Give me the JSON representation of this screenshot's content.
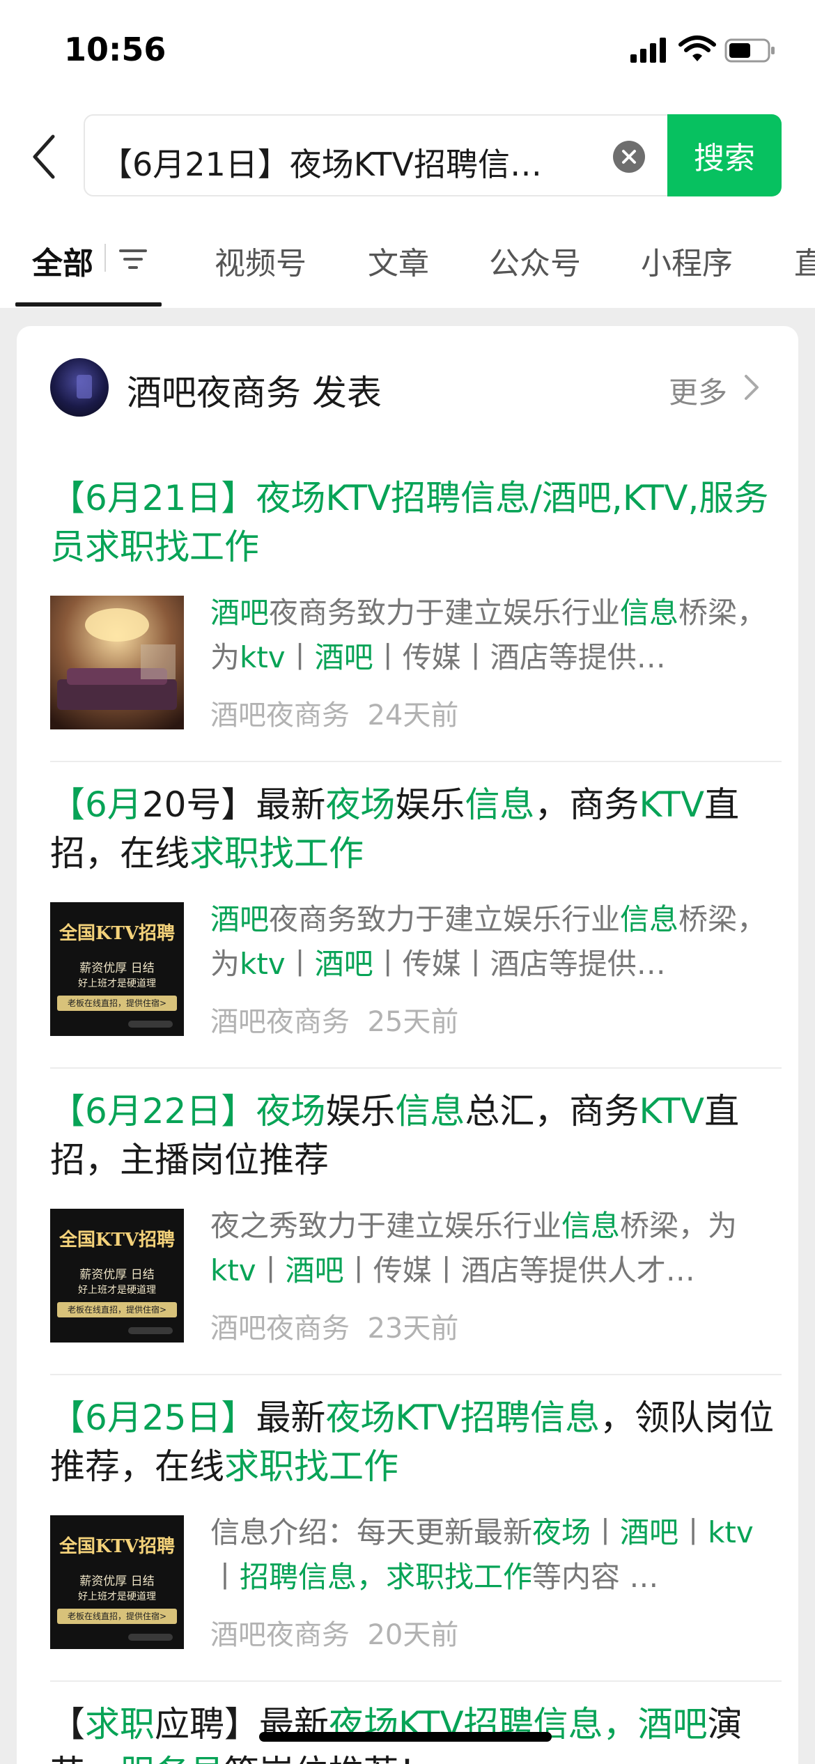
{
  "status_bar": {
    "time": "10:56"
  },
  "search": {
    "query": "【6月21日】夜场KTV招聘信…",
    "button_label": "搜索"
  },
  "tabs": [
    {
      "label": "全部",
      "active": true
    },
    {
      "label": "视频号"
    },
    {
      "label": "文章"
    },
    {
      "label": "公众号"
    },
    {
      "label": "小程序"
    },
    {
      "label": "直"
    }
  ],
  "account": {
    "name": "酒吧夜商务 发表",
    "more_label": "更多"
  },
  "articles": [
    {
      "title_segments": [
        {
          "text": "【6月21日】夜场KTV招聘信息/酒吧,KTV,服务员求职找工作",
          "hl": true
        }
      ],
      "thumb": "luxury-ktv-room-photo",
      "snippet_segments": [
        {
          "text": "酒吧",
          "hl": true
        },
        {
          "text": "夜商务致力于建立娱乐行业"
        },
        {
          "text": "信息",
          "hl": true
        },
        {
          "text": "桥梁，为"
        },
        {
          "text": "ktv",
          "hl": true
        },
        {
          "text": "丨"
        },
        {
          "text": "酒吧",
          "hl": true
        },
        {
          "text": "丨传媒丨酒店等提供…"
        }
      ],
      "source": "酒吧夜商务",
      "time": "24天前"
    },
    {
      "title_segments": [
        {
          "text": "【6月",
          "hl": true
        },
        {
          "text": "20号】最新"
        },
        {
          "text": "夜场",
          "hl": true
        },
        {
          "text": "娱乐"
        },
        {
          "text": "信息",
          "hl": true
        },
        {
          "text": "，商务"
        },
        {
          "text": "KTV",
          "hl": true
        },
        {
          "text": "直招，在线"
        },
        {
          "text": "求职找工作",
          "hl": true
        }
      ],
      "thumb": "ktv-recruit-poster",
      "snippet_segments": [
        {
          "text": "酒吧",
          "hl": true
        },
        {
          "text": "夜商务致力于建立娱乐行业"
        },
        {
          "text": "信息",
          "hl": true
        },
        {
          "text": "桥梁，为"
        },
        {
          "text": "ktv",
          "hl": true
        },
        {
          "text": "丨"
        },
        {
          "text": "酒吧",
          "hl": true
        },
        {
          "text": "丨传媒丨酒店等提供…"
        }
      ],
      "source": "酒吧夜商务",
      "time": "25天前"
    },
    {
      "title_segments": [
        {
          "text": "【6月22日】",
          "hl": true
        },
        {
          "text": "夜场",
          "hl": true
        },
        {
          "text": "娱乐"
        },
        {
          "text": "信息",
          "hl": true
        },
        {
          "text": "总汇，商务"
        },
        {
          "text": "KTV",
          "hl": true
        },
        {
          "text": "直招，主播岗位推荐"
        }
      ],
      "thumb": "ktv-recruit-poster",
      "snippet_segments": [
        {
          "text": "夜之秀致力于建立娱乐行业"
        },
        {
          "text": "信息",
          "hl": true
        },
        {
          "text": "桥梁，为"
        },
        {
          "text": "ktv",
          "hl": true
        },
        {
          "text": "丨"
        },
        {
          "text": "酒吧",
          "hl": true
        },
        {
          "text": "丨传媒丨酒店等提供人才…"
        }
      ],
      "source": "酒吧夜商务",
      "time": "23天前"
    },
    {
      "title_segments": [
        {
          "text": "【6月25日】",
          "hl": true
        },
        {
          "text": "最新"
        },
        {
          "text": "夜场KTV招聘信息",
          "hl": true
        },
        {
          "text": "，领队岗位推荐，在线"
        },
        {
          "text": "求职找工作",
          "hl": true
        }
      ],
      "thumb": "ktv-recruit-poster",
      "snippet_segments": [
        {
          "text": "信息介绍：每天更新最新"
        },
        {
          "text": "夜场",
          "hl": true
        },
        {
          "text": "丨"
        },
        {
          "text": "酒吧",
          "hl": true
        },
        {
          "text": "丨"
        },
        {
          "text": "ktv",
          "hl": true
        },
        {
          "text": "丨"
        },
        {
          "text": "招聘信息，求职找工作",
          "hl": true
        },
        {
          "text": "等内容 …"
        }
      ],
      "source": "酒吧夜商务",
      "time": "20天前"
    },
    {
      "title_segments": [
        {
          "text": "【"
        },
        {
          "text": "求职",
          "hl": true
        },
        {
          "text": "应聘】最新"
        },
        {
          "text": "夜场KTV招聘信息，酒吧",
          "hl": true
        },
        {
          "text": "演艺，"
        },
        {
          "text": "服务员",
          "hl": true
        },
        {
          "text": "等岗位推荐！"
        }
      ]
    }
  ],
  "poster": {
    "title": "全国KTV招聘",
    "line1": "薪资优厚 日结",
    "line2": "好上班才是硬道理",
    "band": "老板在线直招，提供住宿>"
  },
  "colors": {
    "accent": "#07c160",
    "highlight": "#07a356"
  }
}
